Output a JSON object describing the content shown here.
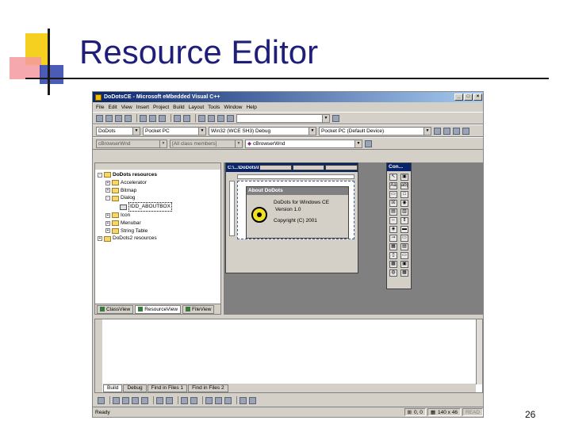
{
  "slide": {
    "title": "Resource Editor",
    "page_number": "26",
    "colors": {
      "title": "#1f1f7a",
      "accent_yellow": "#f5d020",
      "accent_pink": "#f39aa0",
      "accent_blue": "#2a3fa8"
    }
  },
  "window": {
    "title": "DoDotsCE - Microsoft eMbedded Visual C++",
    "buttons": [
      "_",
      "□",
      "×"
    ]
  },
  "menu": [
    "File",
    "Edit",
    "View",
    "Insert",
    "Project",
    "Build",
    "Layout",
    "Tools",
    "Window",
    "Help"
  ],
  "toolbar_row2": {
    "project": "DoDots",
    "platform": "Pocket PC",
    "config": "Win32 (WCE SH3) Debug",
    "device": "Pocket PC (Default Device)"
  },
  "toolbar_row3": {
    "class": "cBrowserWnd",
    "members": "[All class members]",
    "function": "cBrowserWnd"
  },
  "workspace": {
    "tree": [
      {
        "label": "DoDots resources",
        "level": 0,
        "sign": "-",
        "type": "folder"
      },
      {
        "label": "Accelerator",
        "level": 1,
        "sign": "+",
        "type": "folder"
      },
      {
        "label": "Bitmap",
        "level": 1,
        "sign": "+",
        "type": "folder"
      },
      {
        "label": "Dialog",
        "level": 1,
        "sign": "-",
        "type": "folder"
      },
      {
        "label": "IDD_ABOUTBOX",
        "level": 2,
        "sign": "",
        "type": "dialog"
      },
      {
        "label": "Icon",
        "level": 1,
        "sign": "+",
        "type": "folder"
      },
      {
        "label": "Menubar",
        "level": 1,
        "sign": "+",
        "type": "folder"
      },
      {
        "label": "String Table",
        "level": 1,
        "sign": "+",
        "type": "folder"
      },
      {
        "label": "DoDots2 resources",
        "level": 0,
        "sign": "+",
        "type": "folder"
      }
    ],
    "tabs": [
      "ClassView",
      "ResourceView",
      "FileView"
    ],
    "active_tab": "ResourceView"
  },
  "editor": {
    "title": "C:\\...\\DoDots\\DoDots.rc - IDD_ABOUTBOX (...",
    "dialog": {
      "title": "About DoDots",
      "line1": "DoDots for Windows CE",
      "line2": "Version 1.0",
      "line3": "Copyright (C) 2001"
    }
  },
  "controls_palette": {
    "title": "Con...",
    "items": [
      "pointer-icon",
      "picture-icon",
      "static-text-icon",
      "edit-box-icon",
      "group-box-icon",
      "button-icon",
      "checkbox-icon",
      "radio-icon",
      "combo-icon",
      "listbox-icon",
      "hscroll-icon",
      "vscroll-icon",
      "spin-icon",
      "progress-icon",
      "slider-icon",
      "hotkey-icon",
      "listctrl-icon",
      "tree-icon",
      "tab-icon",
      "animate-icon",
      "richedit-icon",
      "date-icon",
      "custom-icon",
      "grid-icon"
    ],
    "glyphs": [
      "↖",
      "▣",
      "Aa",
      "ab|",
      "▭",
      "□",
      "☒",
      "◉",
      "▤",
      "▥",
      "⇔",
      "⇕",
      "◈",
      "▬",
      "⊸",
      "▭",
      "▦",
      "▤",
      "▯",
      "▭",
      "▦",
      "▣",
      "◍",
      "▦"
    ]
  },
  "output": {
    "tabs": [
      "Build",
      "Debug",
      "Find in Files 1",
      "Find in Files 2"
    ],
    "active_tab": "Build"
  },
  "status": {
    "message": "Ready",
    "position": "0, 0",
    "size": "140 x 46",
    "mode": "READ"
  }
}
